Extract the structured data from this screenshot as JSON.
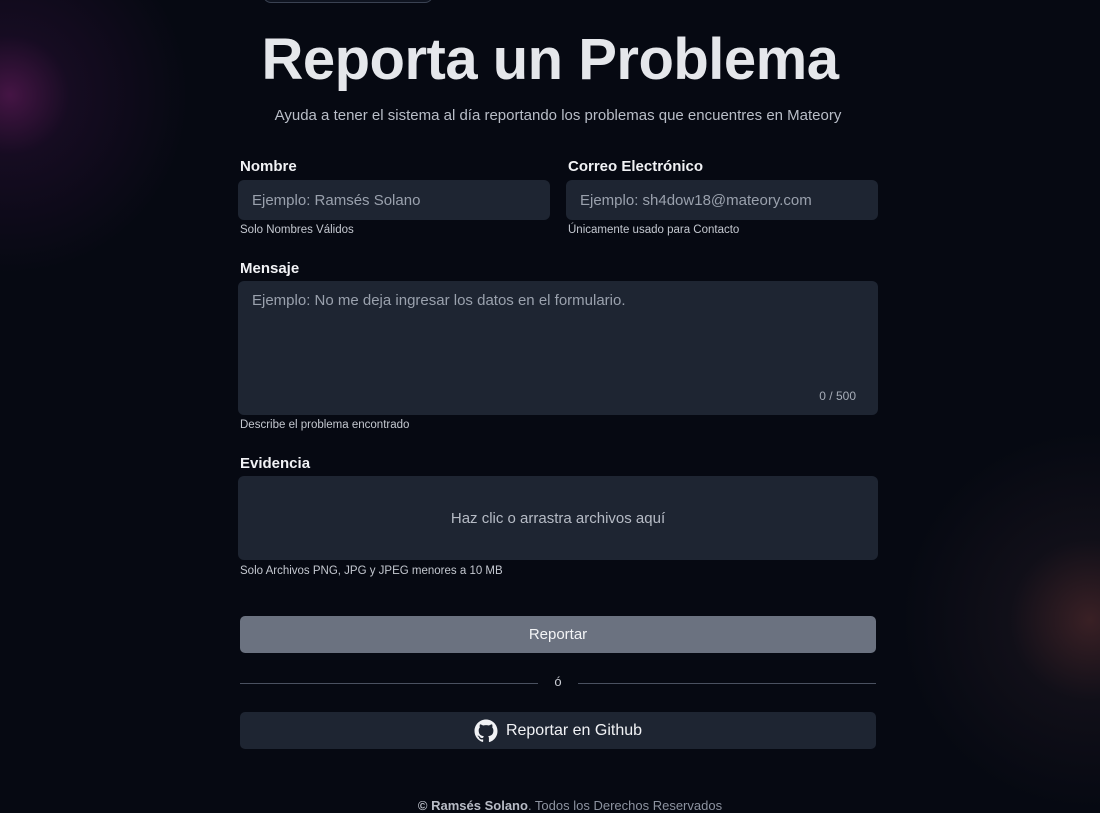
{
  "header": {
    "title": "Reporta un Problema",
    "subtitle": "Ayuda a tener el sistema al día reportando los problemas que encuentres en Mateory"
  },
  "form": {
    "name": {
      "label": "Nombre",
      "placeholder": "Ejemplo: Ramsés Solano",
      "value": "",
      "help": "Solo Nombres Válidos"
    },
    "email": {
      "label": "Correo Electrónico",
      "placeholder": "Ejemplo: sh4dow18@mateory.com",
      "value": "",
      "help": "Únicamente usado para Contacto"
    },
    "message": {
      "label": "Mensaje",
      "placeholder": "Ejemplo: No me deja ingresar los datos en el formulario.",
      "value": "",
      "counter": "0 / 500",
      "help": "Describe el problema encontrado"
    },
    "evidence": {
      "label": "Evidencia",
      "dropzone_text": "Haz clic o arrastra archivos aquí",
      "help": "Solo Archivos PNG, JPG y JPEG menores a 10 MB"
    },
    "submit_label": "Reportar",
    "divider_text": "ó",
    "github_label": "Reportar en Github"
  },
  "footer": {
    "author": "© Ramsés Solano",
    "rights": ". Todos los Derechos Reservados"
  },
  "icons": {
    "github": "github-icon"
  },
  "colors": {
    "background": "#060912",
    "field": "#1e2532",
    "submit_button": "#6b7280"
  }
}
